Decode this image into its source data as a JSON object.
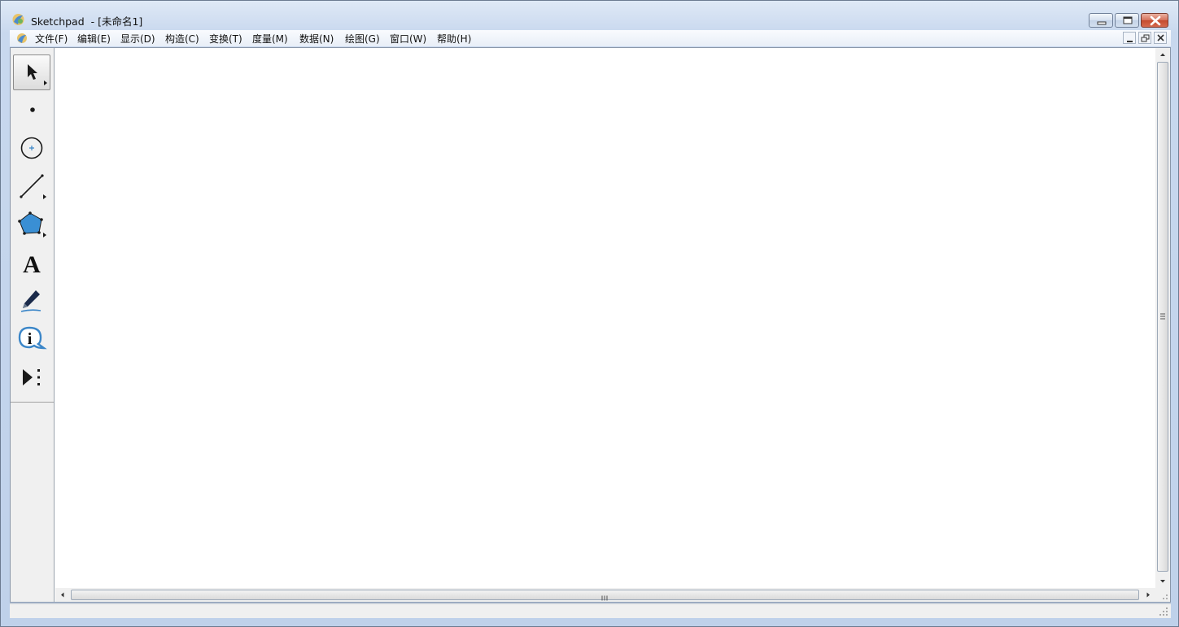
{
  "window": {
    "title": "Sketchpad  - [未命名1]"
  },
  "menubar": {
    "items": [
      {
        "label": "文件(F)"
      },
      {
        "label": "编辑(E)"
      },
      {
        "label": "显示(D)"
      },
      {
        "label": "构造(C)"
      },
      {
        "label": "变换(T)"
      },
      {
        "label": "度量(M)"
      },
      {
        "label": "数据(N)"
      },
      {
        "label": "绘图(G)"
      },
      {
        "label": "窗口(W)"
      },
      {
        "label": "帮助(H)"
      }
    ]
  },
  "toolbox": {
    "tools": [
      {
        "name": "arrow-select-tool",
        "icon": "arrow-icon",
        "active": true
      },
      {
        "name": "point-tool",
        "icon": "point-icon"
      },
      {
        "name": "compass-tool",
        "icon": "circle-icon"
      },
      {
        "name": "straightedge-tool",
        "icon": "segment-icon"
      },
      {
        "name": "polygon-tool",
        "icon": "polygon-icon"
      },
      {
        "name": "text-tool",
        "icon": "text-a-icon",
        "glyph": "A"
      },
      {
        "name": "marker-tool",
        "icon": "pen-icon"
      },
      {
        "name": "information-tool",
        "icon": "info-icon",
        "glyph": "i"
      },
      {
        "name": "custom-tool",
        "icon": "custom-tools-icon"
      }
    ]
  },
  "colors": {
    "polygon_fill": "#3a8fd4",
    "accent_blue": "#3b86c8",
    "close_red": "#c44a2e"
  }
}
